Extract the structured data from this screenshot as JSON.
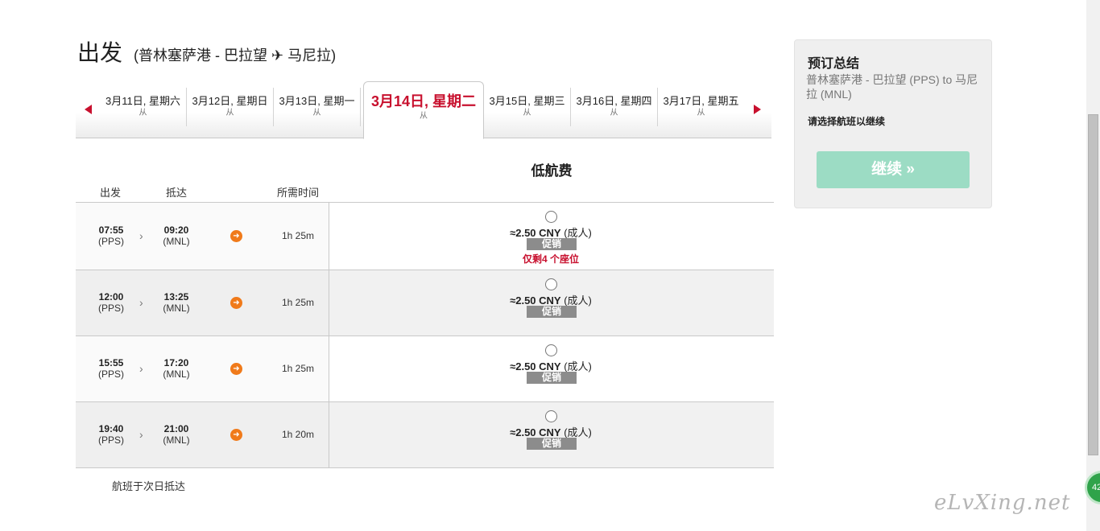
{
  "header": {
    "title": "出发",
    "route": "(普林塞萨港 - 巴拉望 ✈ 马尼拉)"
  },
  "dates": [
    {
      "label": "3月11日, 星期六",
      "mark": "从"
    },
    {
      "label": "3月12日, 星期日",
      "mark": "从"
    },
    {
      "label": "3月13日, 星期一",
      "mark": "从"
    },
    {
      "label": "3月14日, 星期二",
      "mark": "从"
    },
    {
      "label": "3月15日, 星期三",
      "mark": "从"
    },
    {
      "label": "3月16日, 星期四",
      "mark": "从"
    },
    {
      "label": "3月17日, 星期五",
      "mark": "从"
    }
  ],
  "table": {
    "fare_header": "低航费",
    "columns": {
      "depart": "出发",
      "arrive": "抵达",
      "duration": "所需时间"
    },
    "flights": [
      {
        "dep_time": "07:55",
        "dep_code": "(PPS)",
        "arr_time": "09:20",
        "arr_code": "(MNL)",
        "duration": "1h 25m",
        "price": "≈2.50 CNY",
        "pax": "(成人)",
        "promo": "促销",
        "seats": "仅剩4 个座位"
      },
      {
        "dep_time": "12:00",
        "dep_code": "(PPS)",
        "arr_time": "13:25",
        "arr_code": "(MNL)",
        "duration": "1h 25m",
        "price": "≈2.50 CNY",
        "pax": "(成人)",
        "promo": "促销"
      },
      {
        "dep_time": "15:55",
        "dep_code": "(PPS)",
        "arr_time": "17:20",
        "arr_code": "(MNL)",
        "duration": "1h 25m",
        "price": "≈2.50 CNY",
        "pax": "(成人)",
        "promo": "促销"
      },
      {
        "dep_time": "19:40",
        "dep_code": "(PPS)",
        "arr_time": "21:00",
        "arr_code": "(MNL)",
        "duration": "1h 20m",
        "price": "≈2.50 CNY",
        "pax": "(成人)",
        "promo": "促销"
      }
    ],
    "note": "航班于次日抵达"
  },
  "summary": {
    "title": "预订总结",
    "route": "普林塞萨港 - 巴拉望 (PPS) to 马尼拉 (MNL)",
    "hint": "请选择航班以继续",
    "continue_label": "继续 »"
  },
  "badge": "42",
  "watermark": "eLvXing.net",
  "colors": {
    "accent": "#c8102e",
    "plane": "#f07a1a",
    "button": "#9cdcc4"
  },
  "icons": {
    "prev": "arrow-left-icon",
    "next": "arrow-right-icon",
    "plane": "plane-circle-icon",
    "chevron": "chevron-right-icon"
  }
}
